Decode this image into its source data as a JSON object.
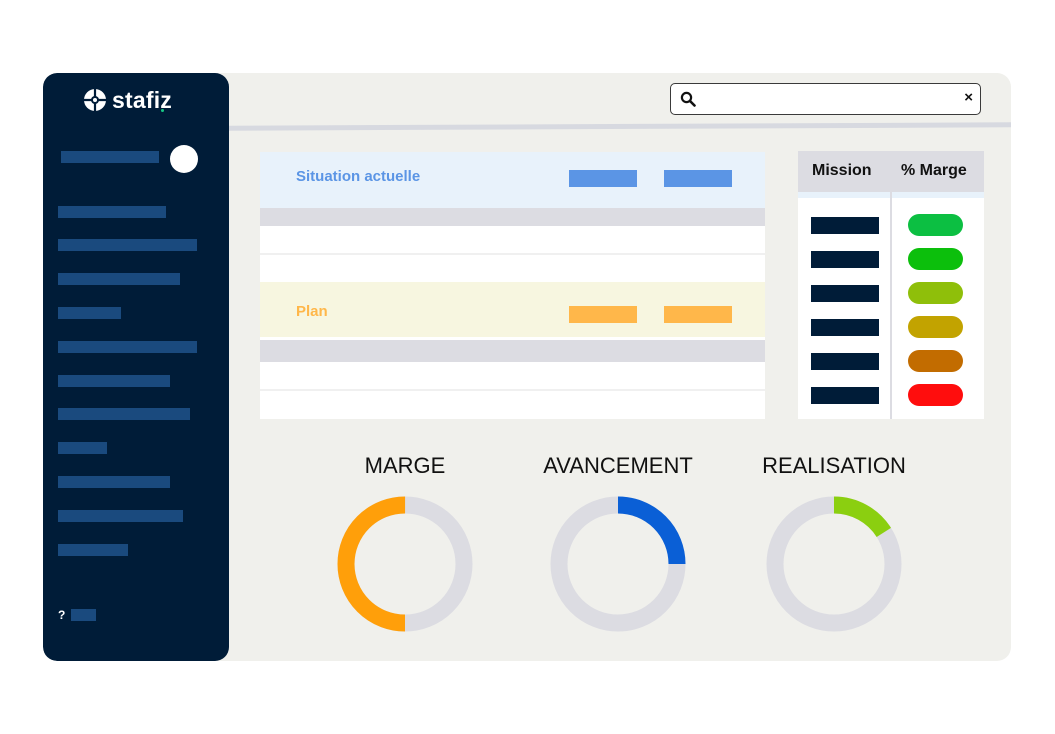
{
  "brand": {
    "name": "stafiz"
  },
  "sidebar": {
    "help_label": "?"
  },
  "search": {
    "value": "",
    "clear_label": "×"
  },
  "situation": {
    "current_label": "Situation actuelle",
    "plan_label": "Plan"
  },
  "mission_table": {
    "headers": [
      "Mission",
      "% Marge"
    ],
    "status_colors": [
      "#0cbf42",
      "#0cbf0c",
      "#8fbf0a",
      "#c2a300",
      "#c26c00",
      "#ff0d0d"
    ]
  },
  "gauges": [
    {
      "title": "MARGE",
      "value": 0.5,
      "color": "#ff9f0a"
    },
    {
      "title": "AVANCEMENT",
      "value": 0.25,
      "color": "#0a5fd6"
    },
    {
      "title": "REALISATION",
      "value": 0.16,
      "color": "#8bcf10"
    }
  ],
  "colors": {
    "sidebar": "#001c38",
    "current_bg": "#e8f2fb",
    "current_accent": "#5b95e5",
    "plan_bg": "#f7f6e0",
    "plan_accent": "#ffb74a",
    "track": "#dcdce2"
  }
}
